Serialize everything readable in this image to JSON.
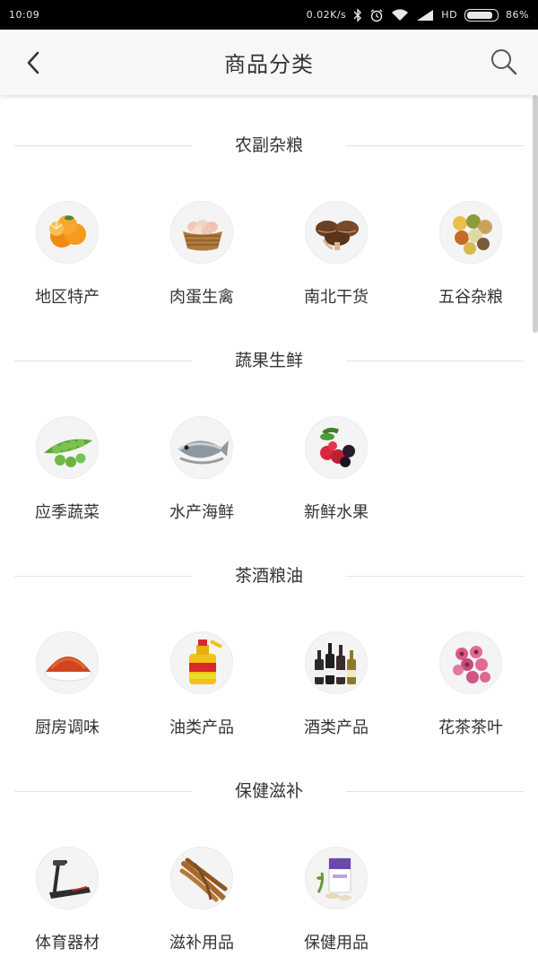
{
  "status_bar": {
    "time": "10:09",
    "net_speed": "0.02K/s",
    "hd_label": "HD",
    "battery": "86%",
    "battery_level": 0.86,
    "icons": [
      "bluetooth-icon",
      "alarm-icon",
      "wifi-icon",
      "signal-icon",
      "battery-icon"
    ]
  },
  "header": {
    "title": "商品分类",
    "back_icon": "chevron-left-icon",
    "search_icon": "search-icon"
  },
  "sections": [
    {
      "title": "农副杂粮",
      "items": [
        {
          "label": "地区特产",
          "icon": "orange-icon"
        },
        {
          "label": "肉蛋生禽",
          "icon": "egg-basket-icon"
        },
        {
          "label": "南北干货",
          "icon": "mushroom-icon"
        },
        {
          "label": "五谷杂粮",
          "icon": "grain-icon"
        }
      ]
    },
    {
      "title": "蔬果生鲜",
      "items": [
        {
          "label": "应季蔬菜",
          "icon": "pea-icon"
        },
        {
          "label": "水产海鲜",
          "icon": "fish-icon"
        },
        {
          "label": "新鲜水果",
          "icon": "berry-icon"
        }
      ]
    },
    {
      "title": "茶酒粮油",
      "items": [
        {
          "label": "厨房调味",
          "icon": "spice-icon"
        },
        {
          "label": "油类产品",
          "icon": "oil-bottle-icon"
        },
        {
          "label": "酒类产品",
          "icon": "wine-bottle-icon"
        },
        {
          "label": "花茶茶叶",
          "icon": "flower-tea-icon"
        }
      ]
    },
    {
      "title": "保健滋补",
      "items": [
        {
          "label": "体育器材",
          "icon": "treadmill-icon"
        },
        {
          "label": "滋补用品",
          "icon": "ginseng-icon"
        },
        {
          "label": "保健用品",
          "icon": "supplement-box-icon"
        }
      ]
    }
  ],
  "colors": {
    "status_bar_bg": "#000000",
    "nav_bg": "#f7f7f7",
    "text": "#333333",
    "divider": "#e2e2e2"
  }
}
